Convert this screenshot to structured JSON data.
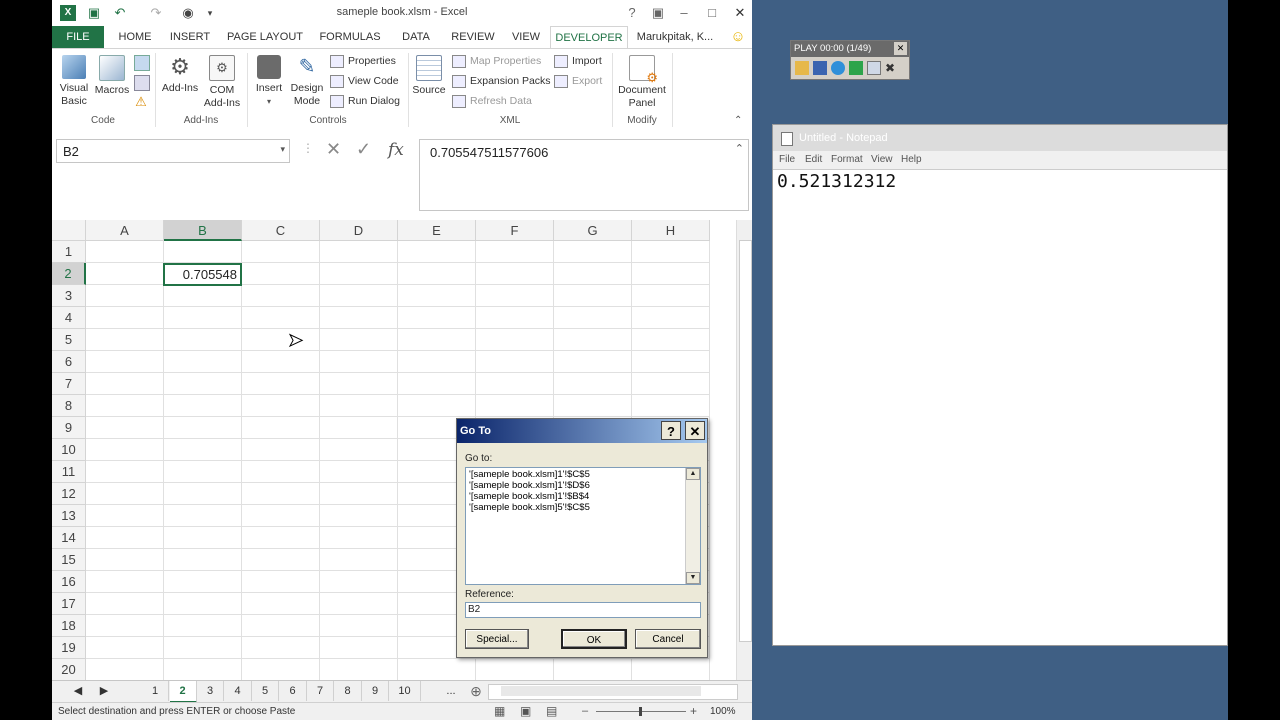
{
  "excel": {
    "title": "sameple book.xlsm - Excel",
    "user": "Marukpitak, K...",
    "tabs": [
      "FILE",
      "HOME",
      "INSERT",
      "PAGE LAYOUT",
      "FORMULAS",
      "DATA",
      "REVIEW",
      "VIEW",
      "DEVELOPER"
    ],
    "active_tab": "DEVELOPER",
    "ribbon": {
      "visual_basic": "Visual Basic",
      "macros": "Macros",
      "add_ins": "Add-Ins",
      "com_add_ins": "COM Add-Ins",
      "insert": "Insert",
      "design_mode": "Design Mode",
      "properties": "Properties",
      "view_code": "View Code",
      "run_dialog": "Run Dialog",
      "source": "Source",
      "map_properties": "Map Properties",
      "expansion_packs": "Expansion Packs",
      "refresh_data": "Refresh Data",
      "import": "Import",
      "export": "Export",
      "document_panel": "Document Panel",
      "groups": {
        "code": "Code",
        "add_ins": "Add-Ins",
        "controls": "Controls",
        "xml": "XML",
        "modify": "Modify"
      }
    },
    "name_box": "B2",
    "formula_value": "0.705547511577606",
    "columns": [
      "A",
      "B",
      "C",
      "D",
      "E",
      "F",
      "G",
      "H"
    ],
    "selected_column": "B",
    "rows": [
      "1",
      "2",
      "3",
      "4",
      "5",
      "6",
      "7",
      "8",
      "9",
      "10",
      "11",
      "12",
      "13",
      "14",
      "15",
      "16",
      "17",
      "18",
      "19",
      "20"
    ],
    "selected_row": "2",
    "cell_b2": "0.705548",
    "sheet_tabs": [
      "1",
      "2",
      "3",
      "4",
      "5",
      "6",
      "7",
      "8",
      "9",
      "10"
    ],
    "active_sheet": "2",
    "sheet_more": "...",
    "status_text": "Select destination and press ENTER or choose Paste",
    "zoom": "100%"
  },
  "goto_dialog": {
    "title": "Go To",
    "goto_label": "Go to:",
    "items": [
      "'[sameple book.xlsm]1'!$C$5",
      "'[sameple book.xlsm]1'!$D$6",
      "'[sameple book.xlsm]1'!$B$4",
      "'[sameple book.xlsm]5'!$C$5"
    ],
    "reference_label": "Reference:",
    "reference_value": "B2",
    "special_button": "Special...",
    "ok_button": "OK",
    "cancel_button": "Cancel"
  },
  "play_widget": {
    "title": "PLAY 00:00 (1/49)"
  },
  "notepad": {
    "title": "Untitled - Notepad",
    "menu": [
      "File",
      "Edit",
      "Format",
      "View",
      "Help"
    ],
    "content": "0.521312312"
  },
  "colors": {
    "excel_green": "#217346",
    "desktop_blue": "#3f5f84"
  }
}
